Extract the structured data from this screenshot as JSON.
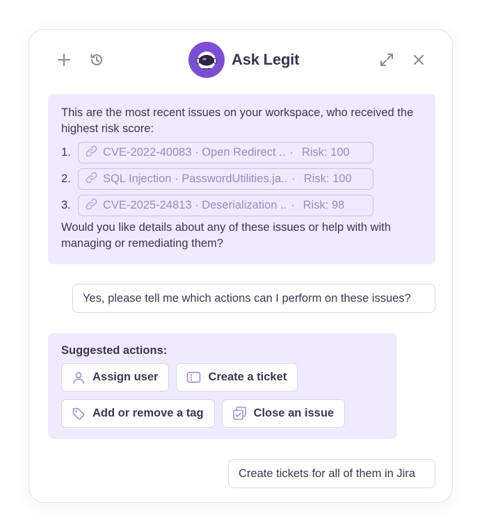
{
  "header": {
    "title": "Ask Legit",
    "icons": {
      "new_chat": "plus-icon",
      "history": "history-icon",
      "logo": "astronaut-avatar-icon",
      "expand": "expand-icon",
      "close": "close-icon"
    }
  },
  "conversation": {
    "bot_intro": "This are the most recent issues on your workspace, who received the highest risk score:",
    "issues": [
      {
        "number": "1.",
        "title": "CVE-2022-40083 · Open Redirect ..",
        "risk": "Risk: 100"
      },
      {
        "number": "2.",
        "title": "SQL Injection · PasswordUtilities.ja..",
        "risk": "Risk: 100"
      },
      {
        "number": "3.",
        "title": "CVE-2025-24813 · Deserialization ..",
        "risk": "Risk: 98"
      }
    ],
    "separator": "·",
    "bot_followup": "Would you like details about any of these issues or help with with managing or remediating them?",
    "user_message_1": "Yes, please tell me which actions can I perform on these issues?",
    "suggested_title": "Suggested actions:",
    "actions": [
      {
        "label": "Assign user",
        "icon": "user-icon"
      },
      {
        "label": "Create a ticket",
        "icon": "ticket-icon"
      },
      {
        "label": "Add or remove a tag",
        "icon": "tag-icon"
      },
      {
        "label": "Close an issue",
        "icon": "close-issue-icon"
      }
    ],
    "user_message_2": "Create tickets for all of them in Jira"
  },
  "colors": {
    "accent": "#7a4fd6",
    "bubble_bg": "#efeafd",
    "chip_border": "#cdbcf3",
    "chip_text": "#9a8cc1",
    "icon_gray": "#8a8696"
  }
}
